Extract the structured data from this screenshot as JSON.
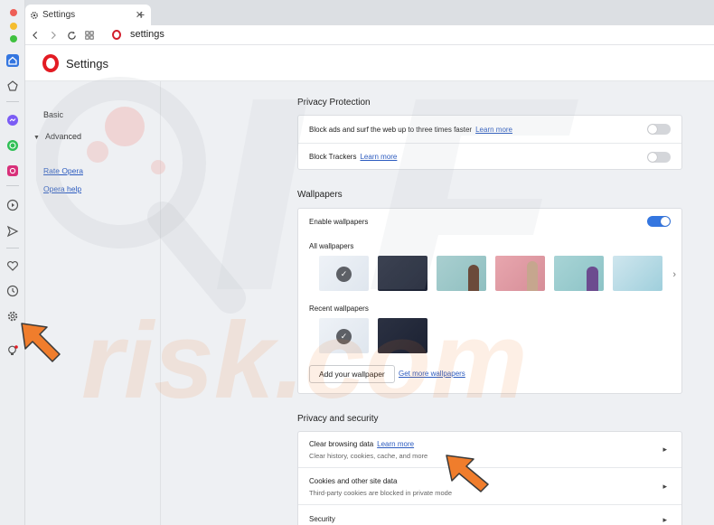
{
  "window": {
    "traffic_lights": [
      "#ee5f57",
      "#f5bd2f",
      "#3fc13f"
    ]
  },
  "tab": {
    "title": "Settings",
    "new_tab_symbol": "+",
    "close_symbol": "✕"
  },
  "address_bar": {
    "url": "settings"
  },
  "header": {
    "title": "Settings"
  },
  "settings_nav": {
    "basic": "Basic",
    "advanced": "Advanced",
    "rate_opera": "Rate Opera",
    "opera_help": "Opera help"
  },
  "privacy_protection": {
    "title": "Privacy Protection",
    "block_ads": {
      "label": "Block ads and surf the web up to three times faster",
      "link": "Learn more",
      "enabled": false
    },
    "block_trackers": {
      "label": "Block Trackers",
      "link": "Learn more",
      "enabled": false
    }
  },
  "wallpapers": {
    "title": "Wallpapers",
    "enable_label": "Enable wallpapers",
    "enabled": true,
    "all_label": "All wallpapers",
    "recent_label": "Recent wallpapers",
    "add_button": "Add your wallpaper",
    "get_more_link": "Get more wallpapers"
  },
  "privacy_security": {
    "title": "Privacy and security",
    "clear_browsing": {
      "label": "Clear browsing data",
      "link": "Learn more",
      "sub": "Clear history, cookies, cache, and more"
    },
    "cookies": {
      "label": "Cookies and other site data",
      "sub": "Third-party cookies are blocked in private mode"
    },
    "security": {
      "label": "Security"
    }
  },
  "colors": {
    "accent": "#3476e0",
    "link": "#2c5bbf",
    "opera_red": "#e31b23",
    "arrow": "#f07d2c"
  }
}
